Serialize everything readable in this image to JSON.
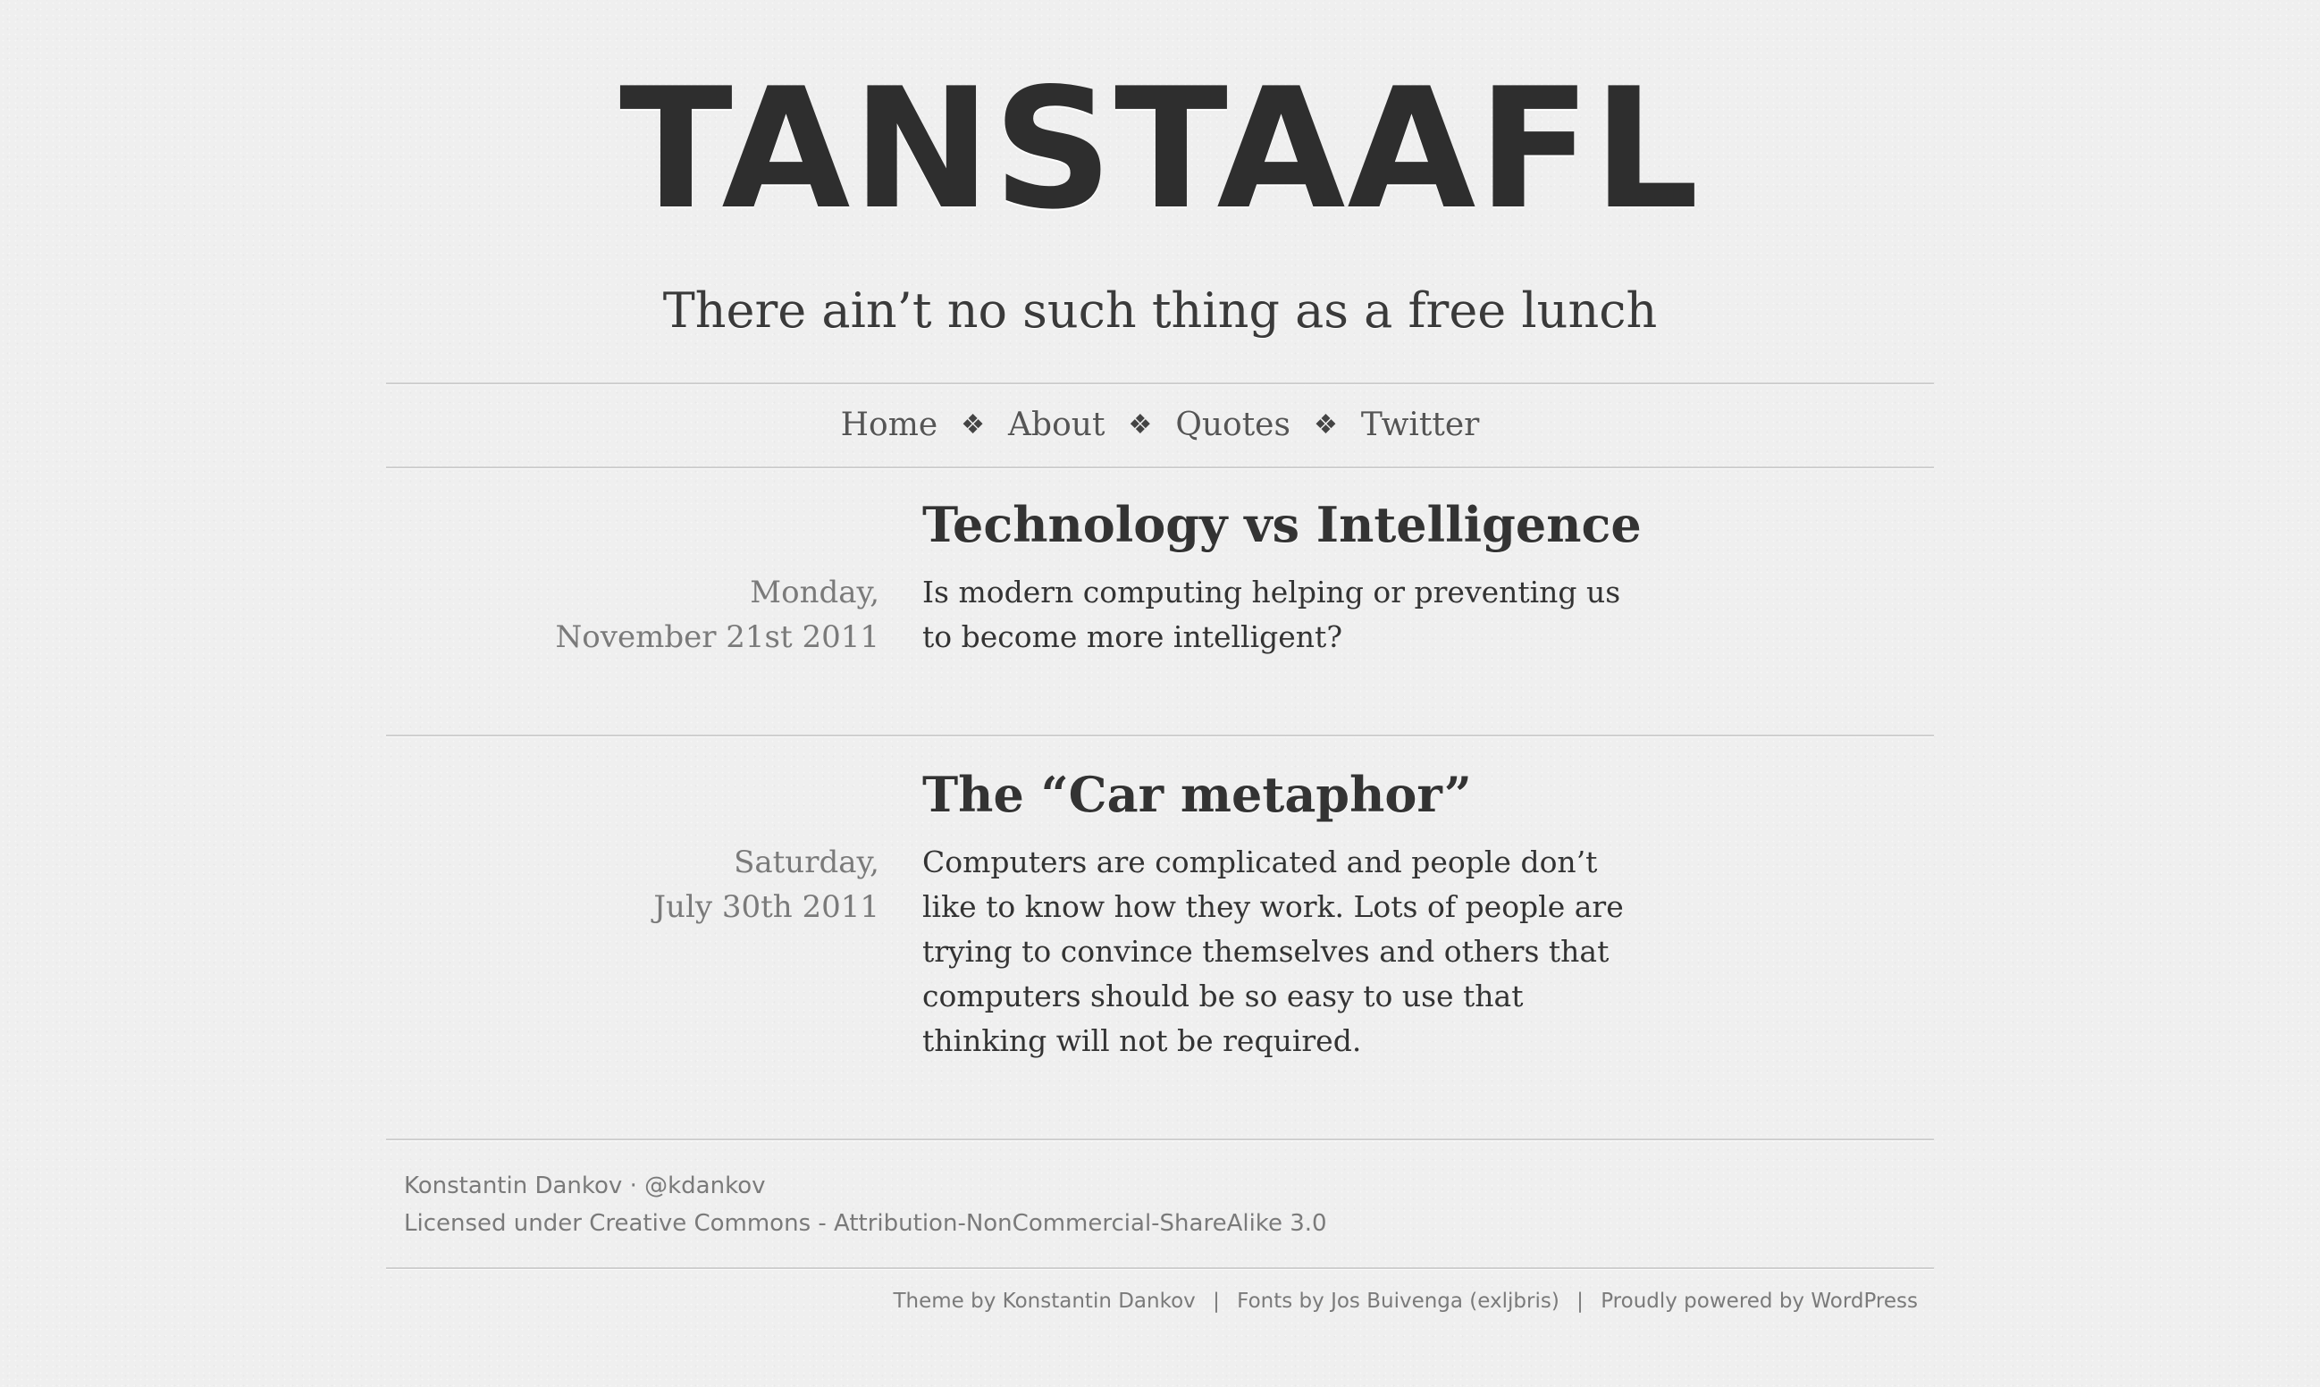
{
  "site": {
    "title": "TANSTAAFL",
    "tagline": "There ain’t no such thing as a free lunch"
  },
  "nav": {
    "items": [
      {
        "label": "Home"
      },
      {
        "label": "About"
      },
      {
        "label": "Quotes"
      },
      {
        "label": "Twitter"
      }
    ],
    "separator": "❖"
  },
  "posts": [
    {
      "title": "Technology vs Intelligence",
      "date_line1": "Monday,",
      "date_line2": "November 21st 2011",
      "excerpt": "Is modern computing helping or preventing us to become more intelligent?"
    },
    {
      "title": "The “Car metaphor”",
      "date_line1": "Saturday,",
      "date_line2": "July 30th 2011",
      "excerpt": "Computers are complicated and people don’t like to know how they work. Lots of people are trying to convince themselves and others that computers should be so easy to use that thinking will not be required."
    }
  ],
  "footer": {
    "author": "Konstantin Dankov",
    "dot": "·",
    "twitter_handle": "@kdankov",
    "license": "Licensed under Creative Commons - Attribution-NonCommercial-ShareAlike 3.0",
    "credits": {
      "theme": "Theme by Konstantin Dankov",
      "fonts": "Fonts by Jos Buivenga (exljbris)",
      "powered": "Proudly powered by WordPress",
      "pipe": "|"
    }
  }
}
